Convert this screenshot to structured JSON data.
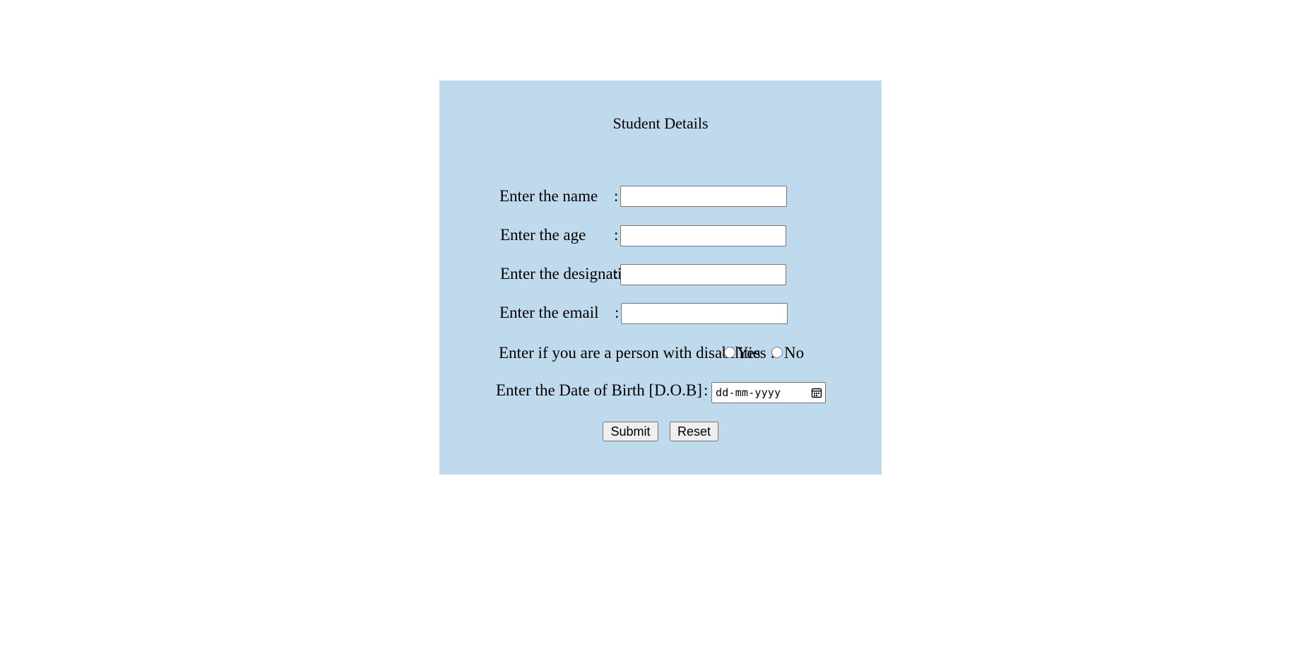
{
  "form": {
    "title": "Student Details",
    "colon": ":",
    "fields": {
      "name": {
        "label": "Enter the name",
        "value": ""
      },
      "age": {
        "label": "Enter the age",
        "value": ""
      },
      "designation": {
        "label": "Enter the designation",
        "value": ""
      },
      "email": {
        "label": "Enter the email",
        "value": ""
      }
    },
    "disability": {
      "label": "Enter if you are a person with disabilities :",
      "options": [
        "Yes",
        "No"
      ],
      "selected": null
    },
    "dob": {
      "label": "Enter the Date of Birth [D.O.B]",
      "placeholder": "dd-mm-yyyy",
      "icon": "calendar-icon"
    },
    "buttons": {
      "submit": "Submit",
      "reset": "Reset"
    }
  },
  "colors": {
    "panel_background": "#bfdaec",
    "page_background": "#ffffff"
  }
}
